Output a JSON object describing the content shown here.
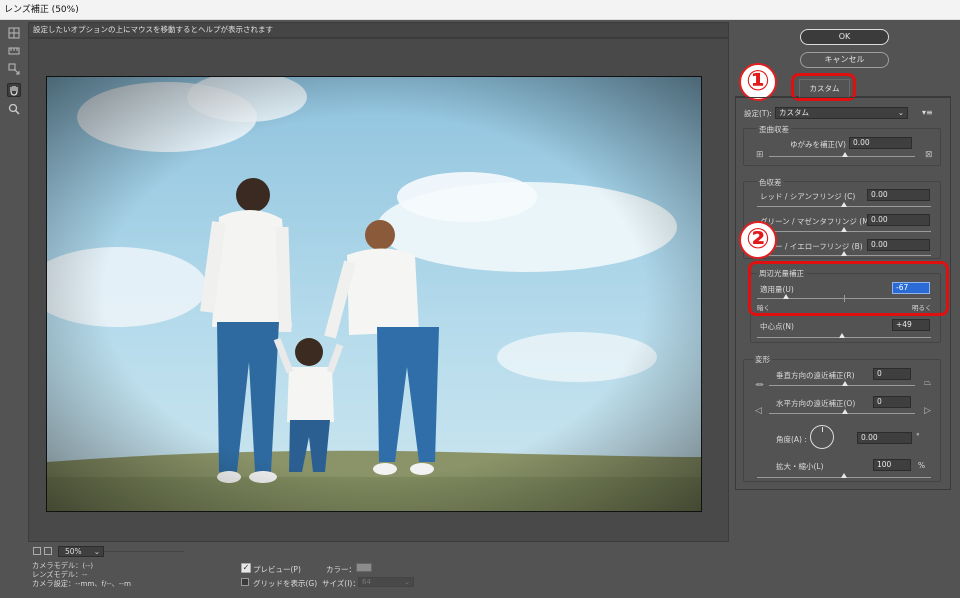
{
  "window": {
    "title": "レンズ補正 (50%)"
  },
  "hint": "設定したいオプションの上にマウスを移動するとヘルプが表示されます",
  "tools": [
    {
      "name": "remove-distortion-icon"
    },
    {
      "name": "straighten-icon"
    },
    {
      "name": "move-grid-icon"
    },
    {
      "name": "hand-icon"
    },
    {
      "name": "zoom-icon"
    }
  ],
  "buttons": {
    "ok": "OK",
    "cancel": "キャンセル"
  },
  "tabs": {
    "custom": "カスタム"
  },
  "annotations": {
    "one": "①",
    "two": "②"
  },
  "settings": {
    "label": "設定(T):",
    "value": "カスタム",
    "menu_icon": "menu-icon"
  },
  "geometric": {
    "title": "歪曲収差",
    "remove_distortion": {
      "label": "ゆがみを補正(V)",
      "value": "0.00"
    }
  },
  "chromatic": {
    "title": "色収差",
    "red_cyan": {
      "label": "レッド / シアンフリンジ (C)",
      "value": "0.00"
    },
    "green_magenta": {
      "label": "グリーン / マゼンタフリンジ (M)",
      "value": "0.00"
    },
    "blue_yellow": {
      "label": "ブルー / イエローフリンジ (B)",
      "value": "0.00"
    }
  },
  "vignette": {
    "title": "周辺光量補正",
    "amount": {
      "label": "適用量(U)",
      "value": "-67",
      "left": "暗く",
      "right": "明るく",
      "level": -0.67
    },
    "midpoint": {
      "label": "中心点(N)",
      "value": "+49",
      "level": 0.49
    }
  },
  "transform": {
    "title": "変形",
    "vertical": {
      "label": "垂直方向の遠近補正(R)",
      "value": "0"
    },
    "horizontal": {
      "label": "水平方向の遠近補正(O)",
      "value": "0"
    },
    "angle": {
      "label": "角度(A) :",
      "value": "0.00",
      "unit": "°"
    },
    "scale": {
      "label": "拡大・縮小(L)",
      "value": "100",
      "unit": "%"
    }
  },
  "zoom": {
    "value": "50%"
  },
  "status": {
    "camera_model": "カメラモデル：(--)",
    "lens_model": "レンズモデル：--",
    "camera_settings": "カメラ設定：--mm、f/--、--m"
  },
  "preview_opts": {
    "preview": "プレビュー(P)",
    "show_grid": "グリッドを表示(G)",
    "color": "カラー：",
    "size": "サイズ(I)：",
    "size_value": "64",
    "grid_color": "#8c8c8c"
  },
  "colors": {
    "accent": "#2a6bd6",
    "highlight": "#e01010"
  }
}
